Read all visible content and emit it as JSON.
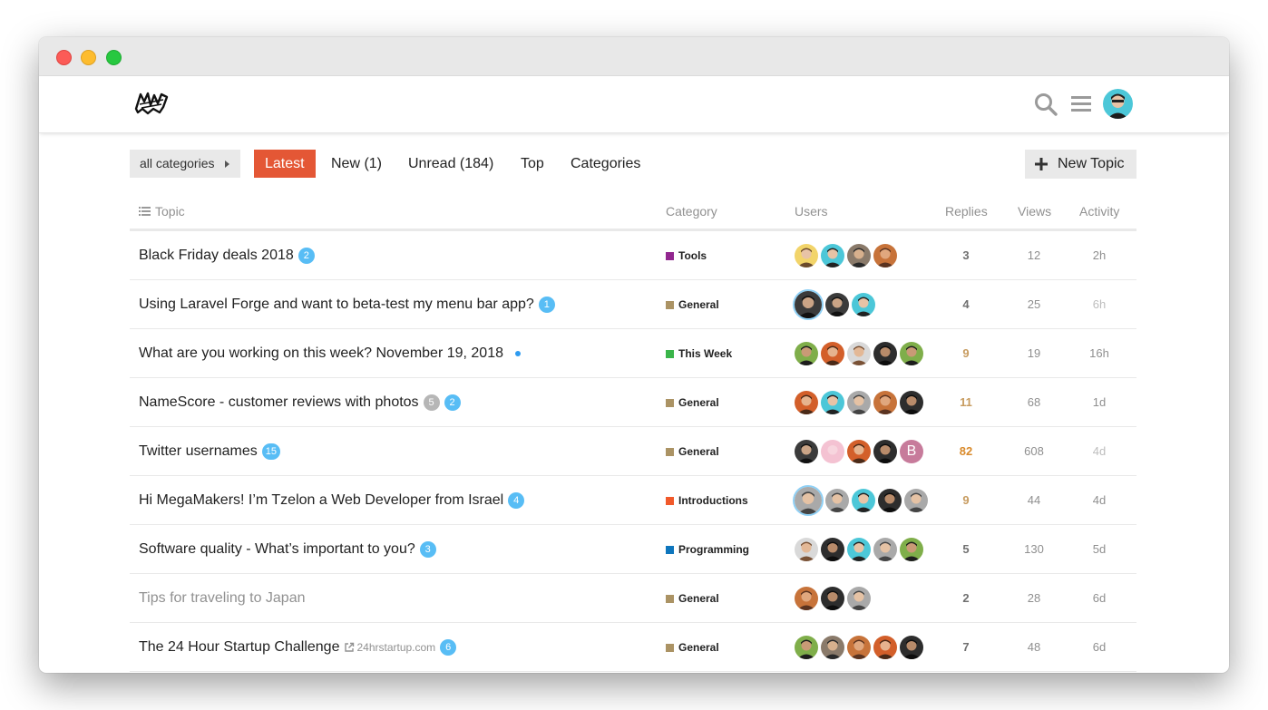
{
  "header": {
    "logo_icon": "megamaker-logo",
    "search_icon": "search-icon",
    "menu_icon": "hamburger-menu-icon",
    "avatar_icon": "user-avatar"
  },
  "nav": {
    "category_dropdown": "all categories",
    "tabs": [
      {
        "label": "Latest",
        "active": true
      },
      {
        "label": "New (1)",
        "active": false
      },
      {
        "label": "Unread (184)",
        "active": false
      },
      {
        "label": "Top",
        "active": false
      },
      {
        "label": "Categories",
        "active": false
      }
    ],
    "new_topic": "New Topic"
  },
  "table": {
    "headers": {
      "topic": "Topic",
      "category": "Category",
      "users": "Users",
      "replies": "Replies",
      "views": "Views",
      "activity": "Activity"
    },
    "rows": [
      {
        "title": "Black Friday deals 2018",
        "badge": "2",
        "category": "Tools",
        "category_color": "#92278f",
        "replies": "3",
        "views": "12",
        "activity": "2h"
      },
      {
        "title": "Using Laravel Forge and want to beta-test my menu bar app?",
        "badge": "1",
        "category": "General",
        "category_color": "#ab9364",
        "replies": "4",
        "views": "25",
        "activity": "6h"
      },
      {
        "title": "What are you working on this week? November 19, 2018",
        "new_dot": true,
        "category": "This Week",
        "category_color": "#3ab54a",
        "replies": "9",
        "views": "19",
        "activity": "16h"
      },
      {
        "title": "NameScore - customer reviews with photos",
        "grey_badge": "5",
        "badge": "2",
        "category": "General",
        "category_color": "#ab9364",
        "replies": "11",
        "views": "68",
        "activity": "1d"
      },
      {
        "title": "Twitter usernames",
        "badge": "15",
        "category": "General",
        "category_color": "#ab9364",
        "replies": "82",
        "views": "608",
        "activity": "4d"
      },
      {
        "title": "Hi MegaMakers! I’m Tzelon a Web Developer from Israel",
        "badge": "4",
        "category": "Introductions",
        "category_color": "#f1592a",
        "replies": "9",
        "views": "44",
        "activity": "4d"
      },
      {
        "title": "Software quality - What’s important to you?",
        "badge": "3",
        "category": "Programming",
        "category_color": "#0e76bd",
        "replies": "5",
        "views": "130",
        "activity": "5d"
      },
      {
        "title": "Tips for traveling to Japan",
        "visited": true,
        "category": "General",
        "category_color": "#ab9364",
        "replies": "2",
        "views": "28",
        "activity": "6d"
      },
      {
        "title": "The 24 Hour Startup Challenge",
        "link_domain": "24hrstartup.com",
        "badge": "6",
        "category": "General",
        "category_color": "#ab9364",
        "replies": "7",
        "views": "48",
        "activity": "6d"
      }
    ]
  }
}
